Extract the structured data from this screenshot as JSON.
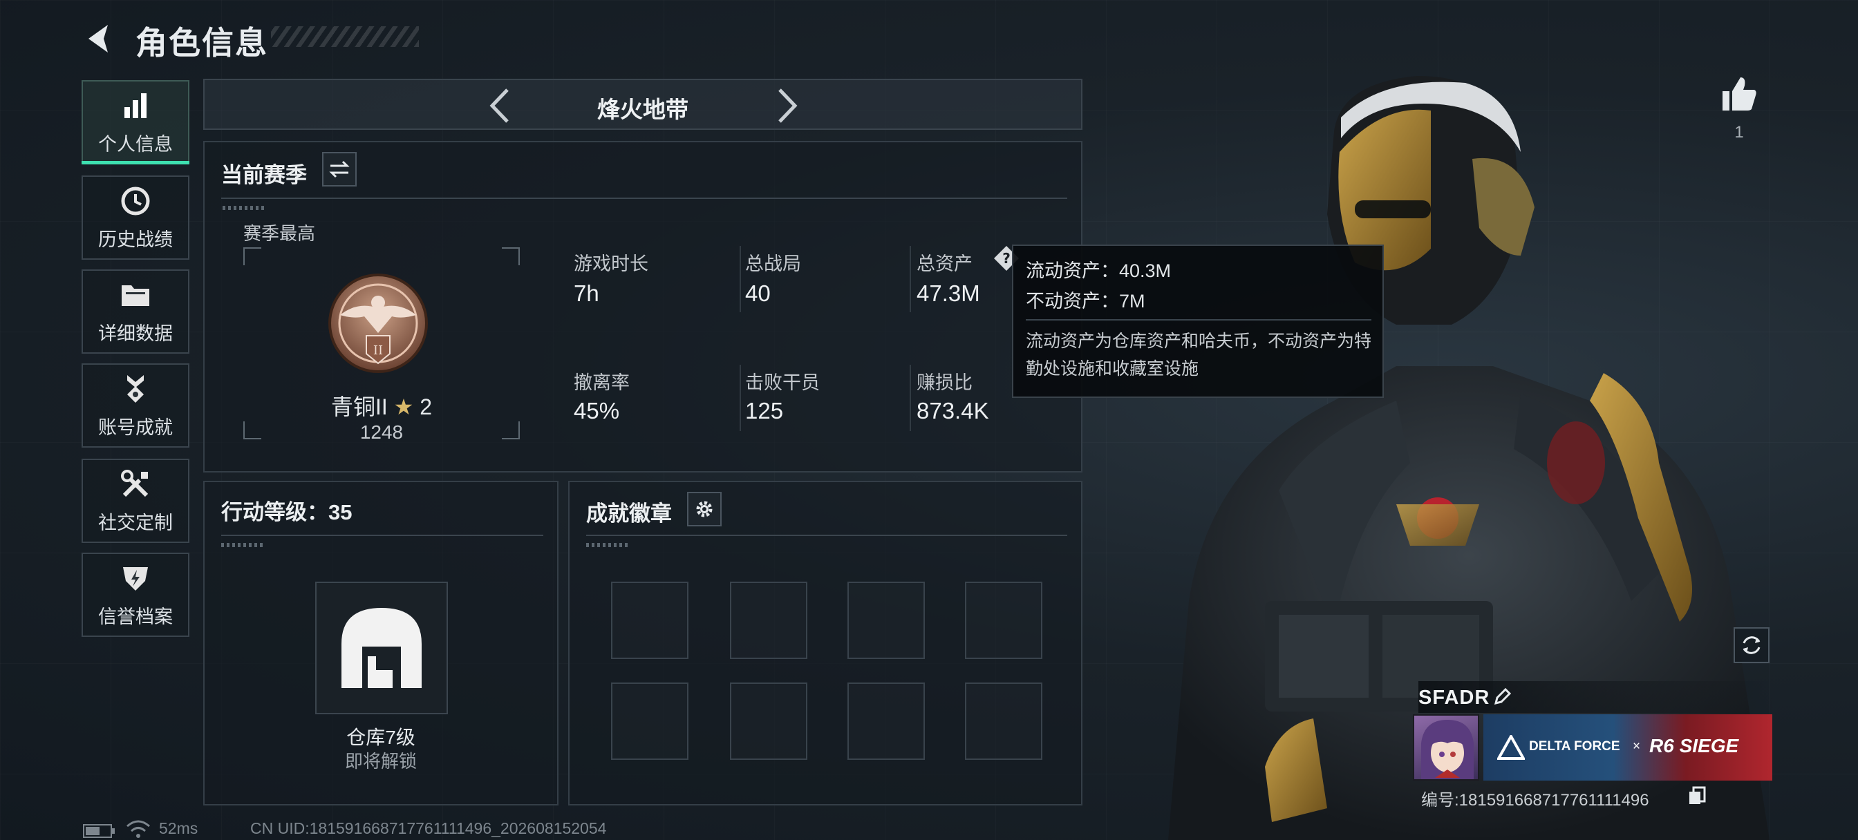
{
  "header": {
    "title": "角色信息"
  },
  "sidebar": {
    "items": [
      {
        "label": "个人信息",
        "icon": "bar-chart-icon",
        "active": true
      },
      {
        "label": "历史战绩",
        "icon": "history-clock-icon",
        "active": false
      },
      {
        "label": "详细数据",
        "icon": "folder-icon",
        "active": false
      },
      {
        "label": "账号成就",
        "icon": "achievement-medal-icon",
        "active": false
      },
      {
        "label": "社交定制",
        "icon": "tools-icon",
        "active": false
      },
      {
        "label": "信誉档案",
        "icon": "shield-bolt-icon",
        "active": false
      }
    ]
  },
  "mode": {
    "label": "烽火地带"
  },
  "season": {
    "title": "当前赛季",
    "best_label": "赛季最高",
    "rank_name": "青铜II",
    "rank_stars": "2",
    "rank_points": "1248",
    "stats": [
      {
        "label": "游戏时长",
        "value": "7h"
      },
      {
        "label": "总战局",
        "value": "40"
      },
      {
        "label": "总资产",
        "value": "47.3M"
      },
      {
        "label": "撤离率",
        "value": "45%"
      },
      {
        "label": "击败干员",
        "value": "125"
      },
      {
        "label": "赚损比",
        "value": "873.4K"
      }
    ]
  },
  "tooltip": {
    "liquid": "流动资产：40.3M",
    "fixed": "不动资产：7M",
    "description": "流动资产为仓库资产和哈夫币，不动资产为特勤处设施和收藏室设施"
  },
  "action": {
    "title": "行动等级：35",
    "warehouse_label": "仓库7级",
    "warehouse_status": "即将解锁"
  },
  "badges": {
    "title": "成就徽章",
    "slots": 8
  },
  "likes": {
    "count": "1"
  },
  "player": {
    "name": "SFADR",
    "id_text": "编号:181591668717761111496",
    "banner_left": "DELTA FORCE",
    "banner_x": "×",
    "banner_right": "R6 SIEGE"
  },
  "footer": {
    "ping": "52ms",
    "uid": "CN UID:181591668717761111496_202608152054"
  }
}
